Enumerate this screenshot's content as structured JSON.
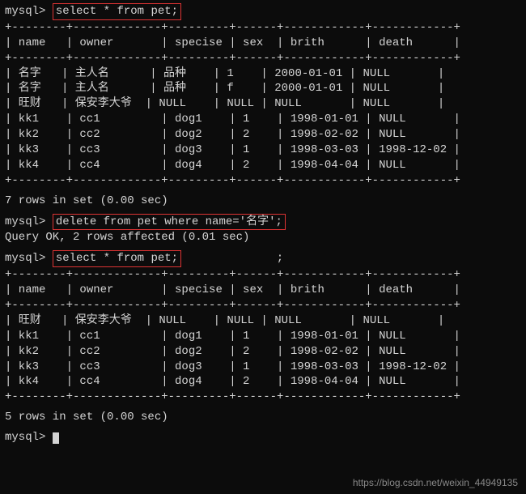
{
  "prompt_label": "mysql>",
  "queries": {
    "q1": "select * from pet;",
    "q2": "delete from pet where name='名字';",
    "q3": "select * from pet;",
    "q3_trailing": ";"
  },
  "responses": {
    "r1_rows": "7 rows in set (0.00 sec)",
    "r2_ok": "Query OK, 2 rows affected (0.01 sec)",
    "r3_rows": "5 rows in set (0.00 sec)"
  },
  "table1": {
    "border": "+--------+-------------+---------+------+------------+------------+",
    "header": "| name   | owner       | specise | sex  | brith      | death      |",
    "rows": [
      "| 名字   | 主人名      | 品种    | 1    | 2000-01-01 | NULL       |",
      "| 名字   | 主人名      | 品种    | f    | 2000-01-01 | NULL       |",
      "| 旺财   | 保安李大爷  | NULL    | NULL | NULL       | NULL       |",
      "| kk1    | cc1         | dog1    | 1    | 1998-01-01 | NULL       |",
      "| kk2    | cc2         | dog2    | 2    | 1998-02-02 | NULL       |",
      "| kk3    | cc3         | dog3    | 1    | 1998-03-03 | 1998-12-02 |",
      "| kk4    | cc4         | dog4    | 2    | 1998-04-04 | NULL       |"
    ]
  },
  "table2": {
    "border": "+--------+-------------+---------+------+------------+------------+",
    "header": "| name   | owner       | specise | sex  | brith      | death      |",
    "rows": [
      "| 旺财   | 保安李大爷  | NULL    | NULL | NULL       | NULL       |",
      "| kk1    | cc1         | dog1    | 1    | 1998-01-01 | NULL       |",
      "| kk2    | cc2         | dog2    | 2    | 1998-02-02 | NULL       |",
      "| kk3    | cc3         | dog3    | 1    | 1998-03-03 | 1998-12-02 |",
      "| kk4    | cc4         | dog4    | 2    | 1998-04-04 | NULL       |"
    ]
  },
  "chart_data": [
    {
      "type": "table",
      "title": "pet (before delete)",
      "columns": [
        "name",
        "owner",
        "specise",
        "sex",
        "brith",
        "death"
      ],
      "rows": [
        [
          "名字",
          "主人名",
          "品种",
          "1",
          "2000-01-01",
          "NULL"
        ],
        [
          "名字",
          "主人名",
          "品种",
          "f",
          "2000-01-01",
          "NULL"
        ],
        [
          "旺财",
          "保安李大爷",
          "NULL",
          "NULL",
          "NULL",
          "NULL"
        ],
        [
          "kk1",
          "cc1",
          "dog1",
          "1",
          "1998-01-01",
          "NULL"
        ],
        [
          "kk2",
          "cc2",
          "dog2",
          "2",
          "1998-02-02",
          "NULL"
        ],
        [
          "kk3",
          "cc3",
          "dog3",
          "1",
          "1998-03-03",
          "1998-12-02"
        ],
        [
          "kk4",
          "cc4",
          "dog4",
          "2",
          "1998-04-04",
          "NULL"
        ]
      ]
    },
    {
      "type": "table",
      "title": "pet (after delete)",
      "columns": [
        "name",
        "owner",
        "specise",
        "sex",
        "brith",
        "death"
      ],
      "rows": [
        [
          "旺财",
          "保安李大爷",
          "NULL",
          "NULL",
          "NULL",
          "NULL"
        ],
        [
          "kk1",
          "cc1",
          "dog1",
          "1",
          "1998-01-01",
          "NULL"
        ],
        [
          "kk2",
          "cc2",
          "dog2",
          "2",
          "1998-02-02",
          "NULL"
        ],
        [
          "kk3",
          "cc3",
          "dog3",
          "1",
          "1998-03-03",
          "1998-12-02"
        ],
        [
          "kk4",
          "cc4",
          "dog4",
          "2",
          "1998-04-04",
          "NULL"
        ]
      ]
    }
  ],
  "watermark": "https://blog.csdn.net/weixin_44949135"
}
